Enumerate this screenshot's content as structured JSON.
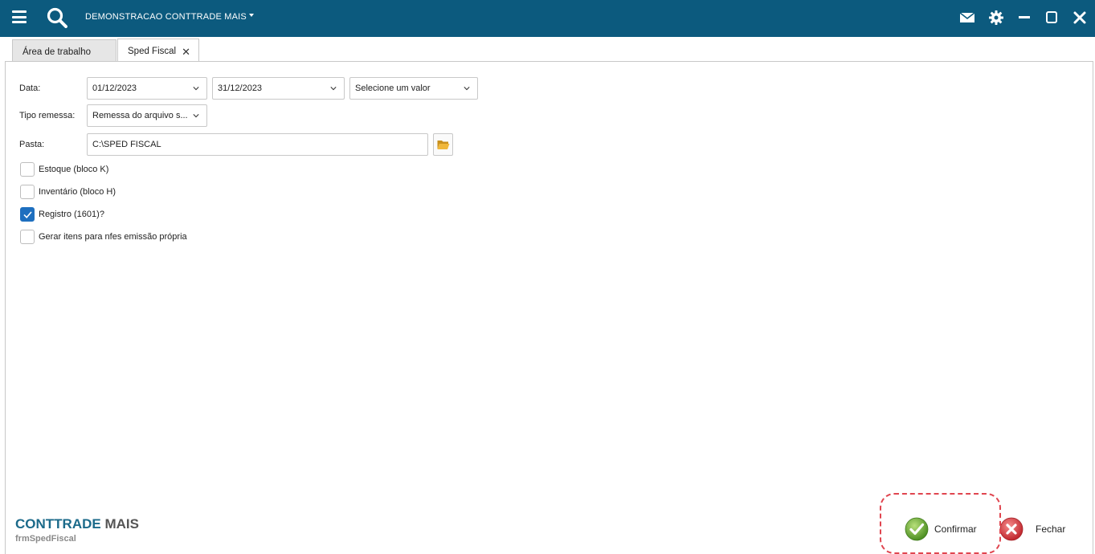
{
  "topbar": {
    "company": "DEMONSTRACAO CONTTRADE MAIS",
    "icons": [
      "menu-icon",
      "search-icon",
      "envelope-icon",
      "gear-icon",
      "minimize-icon",
      "maximize-icon",
      "close-icon"
    ],
    "background_color": "#0c5a7e"
  },
  "tabs": [
    {
      "label": "Área de trabalho",
      "active": false
    },
    {
      "label": "Sped Fiscal",
      "active": true
    }
  ],
  "form": {
    "data_label": "Data:",
    "date_from": "01/12/2023",
    "date_to": "31/12/2023",
    "select_placeholder": "Selecione um valor",
    "tipo_label": "Tipo remessa:",
    "tipo_value": "Remessa do arquivo s...",
    "pasta_label": "Pasta:",
    "pasta_value": "C:\\SPED FISCAL",
    "checkboxes": [
      {
        "label": "Estoque (bloco K)",
        "checked": false
      },
      {
        "label": "Inventário (bloco H)",
        "checked": false
      },
      {
        "label": "Registro (1601)?",
        "checked": true
      },
      {
        "label": "Gerar itens para nfes emissão própria",
        "checked": false
      }
    ]
  },
  "footer": {
    "brand_part1": "CONTTRADE",
    "brand_part2": " MAIS",
    "form_name": "frmSpedFiscal",
    "confirm_label": "Confirmar",
    "close_label": "Fechar"
  },
  "colors": {
    "accent": "#0c5a7e",
    "checkbox_checked": "#1e6fbf",
    "highlight": "#e0454f",
    "confirm_green": "#5aa02c",
    "close_red": "#d8333a"
  }
}
